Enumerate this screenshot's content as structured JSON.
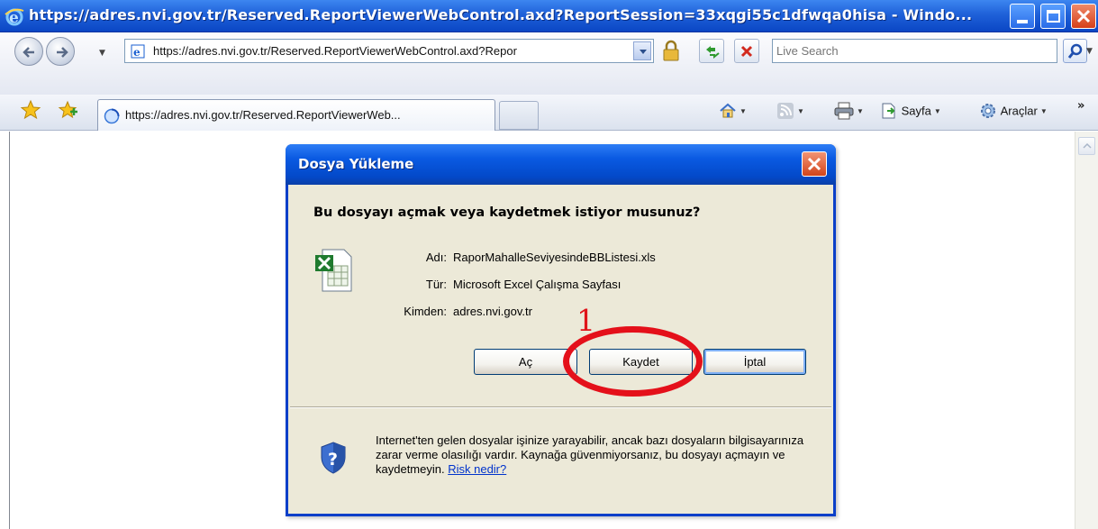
{
  "window": {
    "title": "https://adres.nvi.gov.tr/Reserved.ReportViewerWebControl.axd?ReportSession=33xqgi55c1dfwqa0hisa - Windo...",
    "caption_buttons": [
      "minimize-icon",
      "maximize-icon",
      "close-icon"
    ]
  },
  "addressbar": {
    "url": "https://adres.nvi.gov.tr/Reserved.ReportViewerWebControl.axd?Repor",
    "search_placeholder": "Live Search"
  },
  "tabs": {
    "active_label": "https://adres.nvi.gov.tr/Reserved.ReportViewerWeb..."
  },
  "commandbar": {
    "page_label": "Sayfa",
    "tools_label": "Araçlar",
    "overflow": "»"
  },
  "dialog": {
    "title": "Dosya Yükleme",
    "question": "Bu dosyayı açmak veya kaydetmek istiyor musunuz?",
    "fields": [
      {
        "label": "Adı:",
        "value": "RaporMahalleSeviyesindeBBListesi.xls"
      },
      {
        "label": "Tür:",
        "value": "Microsoft Excel Çalışma Sayfası"
      },
      {
        "label": "Kimden:",
        "value": "adres.nvi.gov.tr"
      }
    ],
    "buttons": {
      "open": "Aç",
      "save": "Kaydet",
      "cancel": "İptal"
    },
    "warning_text": "Internet'ten gelen dosyalar işinize yarayabilir, ancak bazı dosyaların bilgisayarınıza zarar verme olasılığı vardır. Kaynağa güvenmiyorsanız, bu dosyayı açmayın ve kaydetmeyin.",
    "risk_link": "Risk nedir?"
  },
  "annotation": {
    "number": "1",
    "color": "#e4101a"
  },
  "colors": {
    "titlebar": "#0a46c4",
    "dialog_bg": "#ece9d8",
    "link": "#0033cc"
  }
}
